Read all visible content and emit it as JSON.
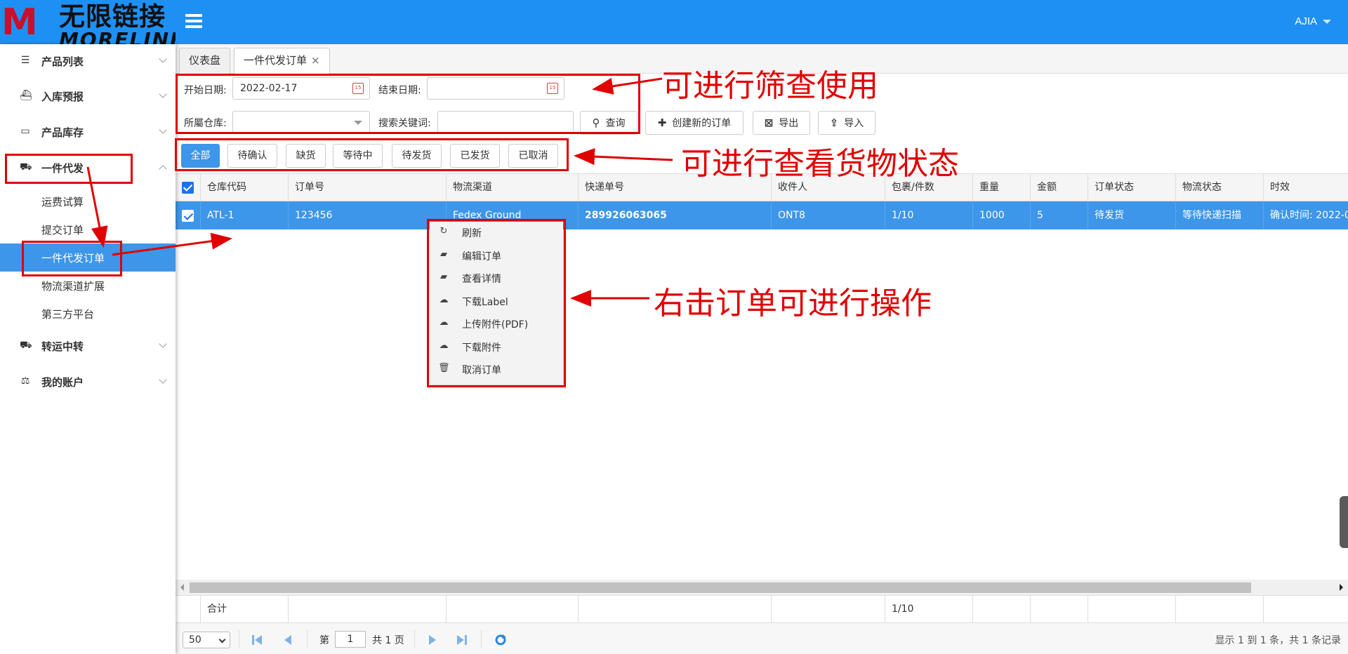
{
  "brand": {
    "mark": "M",
    "name_cn": "无限链接",
    "name_en": "MORELINK"
  },
  "header": {
    "user": "AJIA"
  },
  "sidebar": {
    "groups": [
      {
        "label": "产品列表",
        "icon": "list-icon"
      },
      {
        "label": "入库预报",
        "icon": "ship-icon"
      },
      {
        "label": "产品库存",
        "icon": "inbox-icon"
      },
      {
        "label": "一件代发",
        "icon": "truck-icon",
        "expanded": true
      },
      {
        "label": "转运中转",
        "icon": "truck-icon"
      },
      {
        "label": "我的账户",
        "icon": "scale-icon"
      }
    ],
    "sub_items": [
      {
        "label": "运费试算"
      },
      {
        "label": "提交订单"
      },
      {
        "label": "一件代发订单",
        "active": true
      },
      {
        "label": "物流渠道扩展"
      },
      {
        "label": "第三方平台"
      }
    ]
  },
  "tabs": [
    {
      "label": "仪表盘"
    },
    {
      "label": "一件代发订单",
      "active": true,
      "close": "×"
    }
  ],
  "filters": {
    "start_date_label": "开始日期:",
    "start_date_value": "2022-02-17",
    "end_date_label": "结束日期:",
    "end_date_value": "",
    "warehouse_label": "所屬仓库:",
    "warehouse_value": "",
    "keyword_label": "搜索关键词:",
    "keyword_value": "",
    "query_button": "查询",
    "create_button": "创建新的订单",
    "export_button": "导出",
    "import_button": "导入"
  },
  "status_tabs": [
    {
      "label": "全部",
      "active": true
    },
    {
      "label": "待确认"
    },
    {
      "label": "缺货"
    },
    {
      "label": "等待中"
    },
    {
      "label": "待发货"
    },
    {
      "label": "已发货"
    },
    {
      "label": "已取消"
    }
  ],
  "table": {
    "columns": [
      "仓库代码",
      "订单号",
      "物流渠道",
      "快递单号",
      "收件人",
      "包裹/件数",
      "重量",
      "金额",
      "订单状态",
      "物流状态",
      "时效"
    ],
    "rows": [
      [
        "ATL-1",
        "123456",
        "Fedex Ground",
        "289926063065",
        "ONT8",
        "1/10",
        "1000",
        "5",
        "待发货",
        "等待快递扫描",
        "确认时间: 2022-0"
      ]
    ],
    "footer": {
      "label": "合计",
      "packages": "1/10"
    }
  },
  "pager": {
    "page_size": "50",
    "page_prefix": "第",
    "page_value": "1",
    "page_suffix": "共 1 页",
    "summary": "显示 1 到 1 条，共 1 条记录"
  },
  "context_menu": [
    {
      "label": "刷新",
      "icon": "refresh-icon"
    },
    {
      "label": "编辑订单",
      "icon": "book-icon"
    },
    {
      "label": "查看详情",
      "icon": "book-icon"
    },
    {
      "label": "下载Label",
      "icon": "cloud-download-icon"
    },
    {
      "label": "上传附件(PDF)",
      "icon": "cloud-upload-icon"
    },
    {
      "label": "下载附件",
      "icon": "cloud-download-icon"
    },
    {
      "label": "取消订单",
      "icon": "trash-icon"
    }
  ],
  "annotations": {
    "filter_note": "可进行筛查使用",
    "status_note": "可进行查看货物状态",
    "context_note": "右击订单可进行操作"
  },
  "colors": {
    "header": "#1e90f3",
    "selected": "#3d96e9",
    "annotation": "#e00000"
  }
}
